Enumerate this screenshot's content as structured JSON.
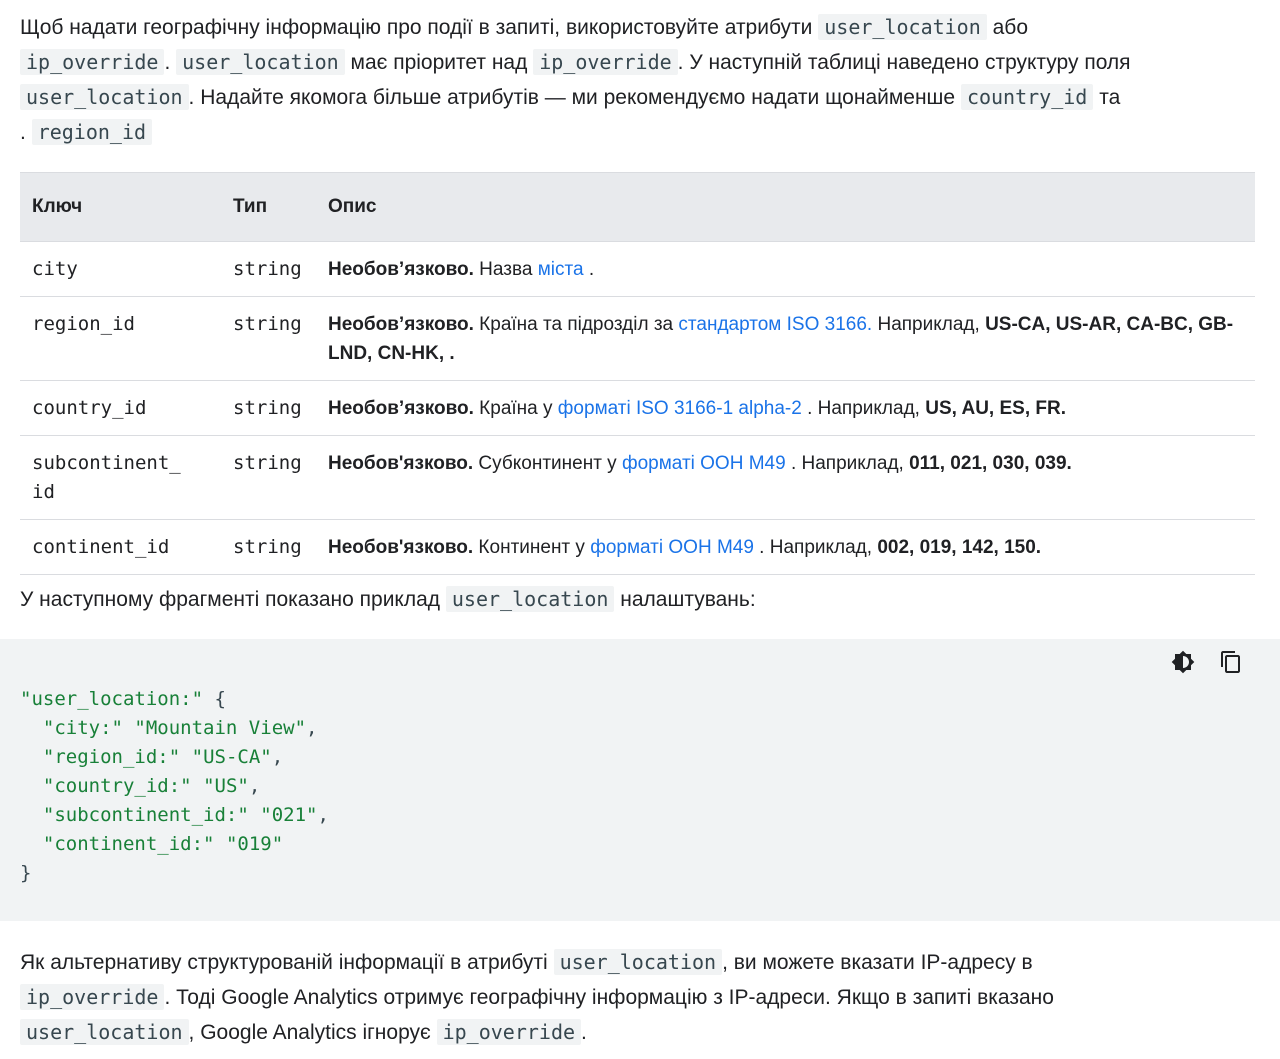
{
  "intro": {
    "p1": "Щоб надати географічну інформацію про події в запиті, використовуйте атрибути",
    "code1": "user_location",
    "p2": "або",
    "code2": "ip_override",
    "p3": ".",
    "code3": "user_location",
    "p4": "має пріоритет над",
    "code4": "ip_override",
    "p5": ". У наступній таблиці наведено структуру поля",
    "code5": "user_location",
    "p6": ". Надайте якомога більше атрибутів — ми рекомендуємо надати щонайменше",
    "code6": "country_id",
    "p7": "та",
    "p8": ".",
    "code7": "region_id"
  },
  "table": {
    "headers": [
      "Ключ",
      "Тип",
      "Опис"
    ],
    "rows": [
      {
        "key": "city",
        "type": "string",
        "bold": "Необов’язково.",
        "text1": " Назва ",
        "link": "міста",
        "text2": " .",
        "extra": ""
      },
      {
        "key": "region_id",
        "type": "string",
        "bold": "Необов’язково.",
        "text1": " Країна та підрозділ за ",
        "link": "стандартом ISO 3166.",
        "text2": " Наприклад, ",
        "extra": "US-CA, US-AR, CA-BC, GB-LND, CN-HK, ."
      },
      {
        "key": "country_id",
        "type": "string",
        "bold": "Необов’язково.",
        "text1": " Країна у ",
        "link": "форматі ISO 3166-1 alpha-2",
        "text2": " . Наприклад, ",
        "extra": "US, AU, ES, FR."
      },
      {
        "key": "subcontinent_\nid",
        "type": "string",
        "bold": "Необов'язково.",
        "text1": " Субконтинент у ",
        "link": "форматі ООН M49",
        "text2": " . Наприклад, ",
        "extra": "011, 021, 030, 039."
      },
      {
        "key": "continent_id",
        "type": "string",
        "bold": "Необов'язково.",
        "text1": " Континент у ",
        "link": "форматі ООН M49",
        "text2": " . Наприклад, ",
        "extra": "002, 019, 142, 150."
      }
    ]
  },
  "snippet_intro": {
    "p1": "У наступному фрагменті показано приклад",
    "code": "user_location",
    "p2": "налаштувань:"
  },
  "code_block": {
    "line1_key": "\"user_location:\"",
    "line1_rest": " {",
    "lines": [
      {
        "k": "\"city:\"",
        "v": "\"Mountain View\"",
        "end": ","
      },
      {
        "k": "\"region_id:\"",
        "v": "\"US-CA\"",
        "end": ","
      },
      {
        "k": "\"country_id:\"",
        "v": "\"US\"",
        "end": ","
      },
      {
        "k": "\"subcontinent_id:\"",
        "v": "\"021\"",
        "end": ","
      },
      {
        "k": "\"continent_id:\"",
        "v": "\"019\"",
        "end": ""
      }
    ],
    "closing": "}",
    "icons": [
      "theme-toggle-icon",
      "copy-icon"
    ]
  },
  "outro": {
    "p1": "Як альтернативу структурованій інформації в атрибуті",
    "code1": "user_location",
    "p2": ", ви можете вказати IP-адресу в",
    "code2": "ip_override",
    "p3": ". Тоді Google Analytics отримує географічну інформацію з IP-адреси. Якщо в запиті вказано",
    "code3": "user_location",
    "p4": ", Google Analytics ігнорує",
    "code4": "ip_override",
    "p5": "."
  }
}
